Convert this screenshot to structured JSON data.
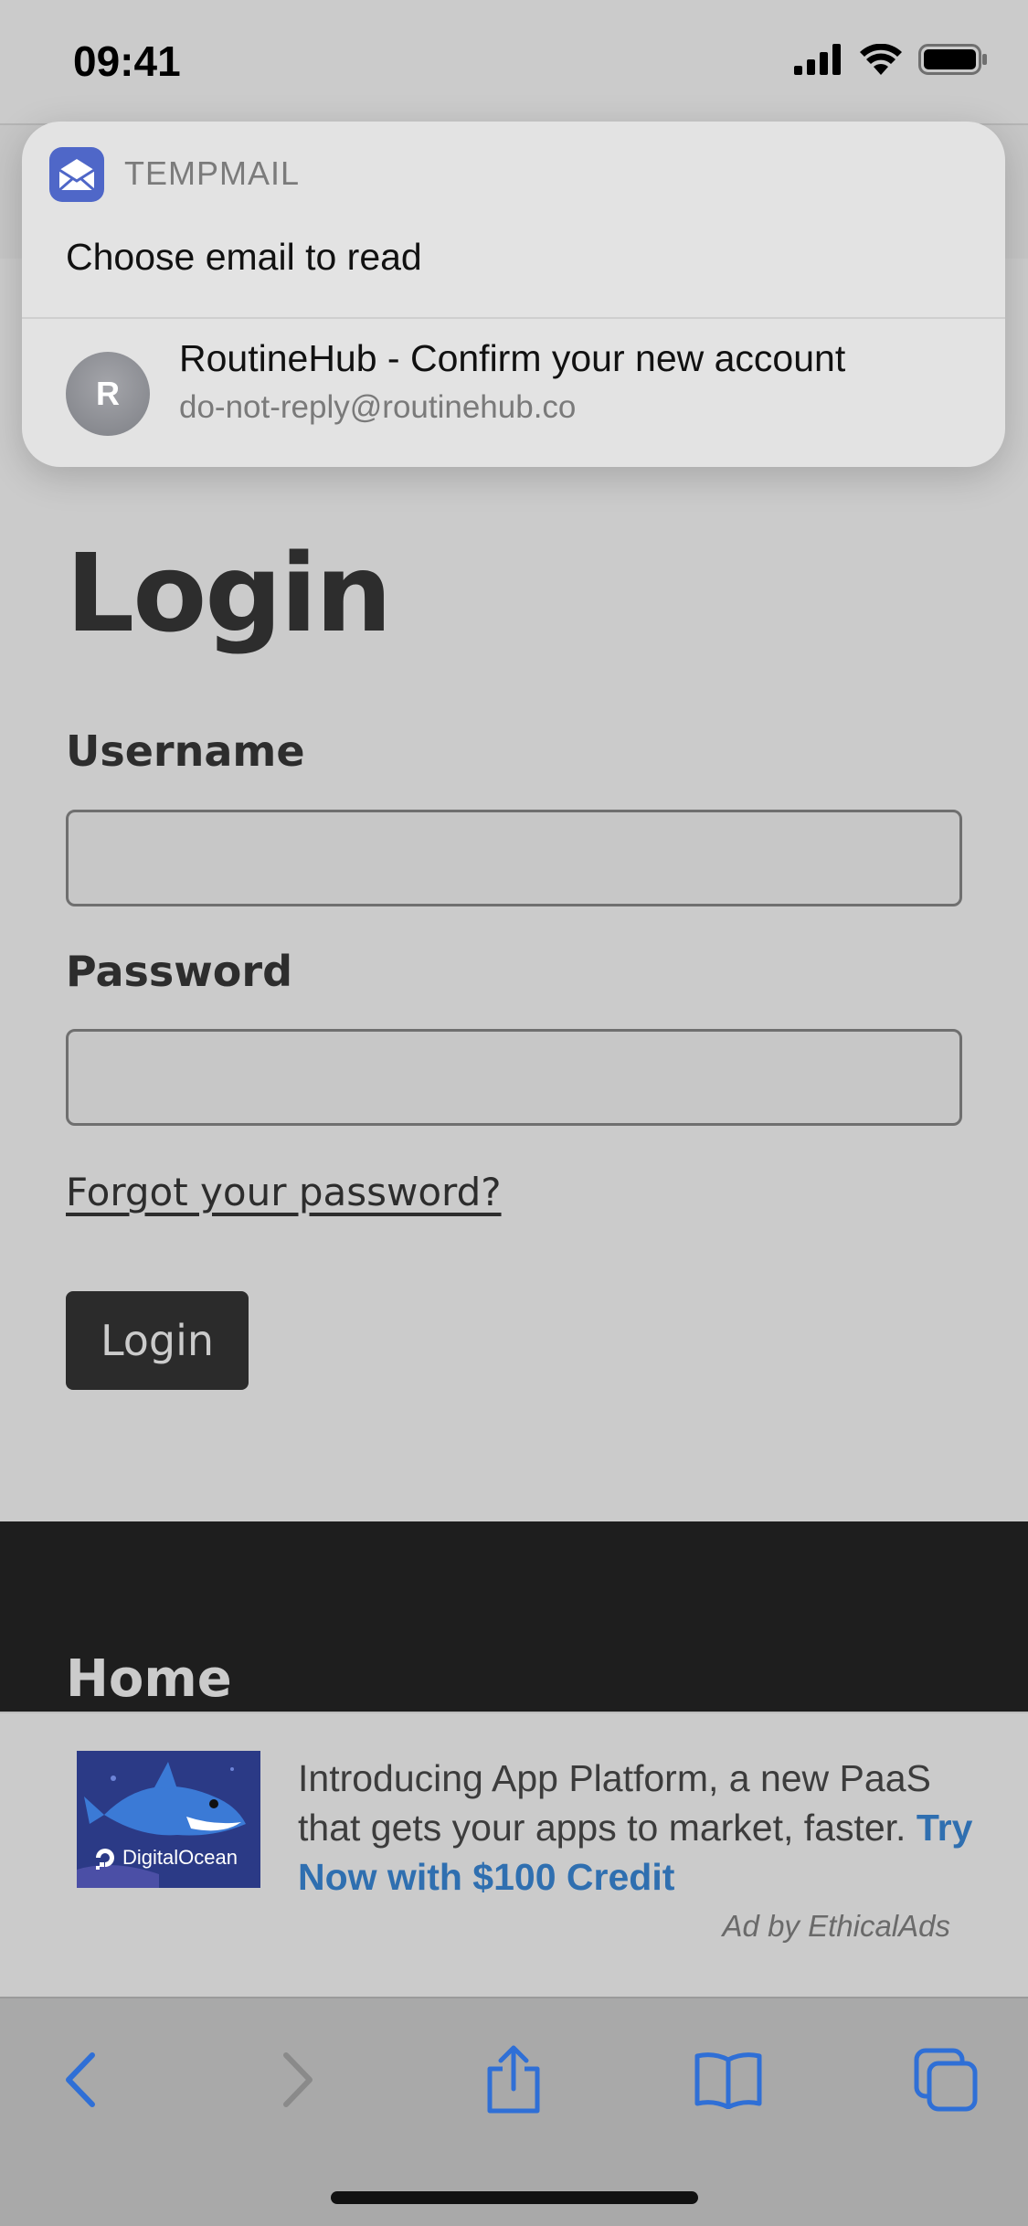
{
  "status_bar": {
    "time": "09:41"
  },
  "notification": {
    "app_name": "TEMPMAIL",
    "title": "Choose email to read",
    "email": {
      "avatar_initial": "R",
      "subject": "RoutineHub - Confirm your new account",
      "sender": "do-not-reply@routinehub.co"
    },
    "app_icon": "envelope-icon",
    "accent_color": "#4f67c8"
  },
  "login": {
    "heading": "Login",
    "username_label": "Username",
    "username_value": "",
    "password_label": "Password",
    "password_value": "",
    "forgot_link": "Forgot your password?",
    "button_label": "Login"
  },
  "footer": {
    "home_label": "Home"
  },
  "ad": {
    "image_brand": "DigitalOcean",
    "text": "Introducing App Platform, a new PaaS that gets your apps to market, faster.",
    "cta": "Try Now with $100 Credit",
    "credit": "Ad by EthicalAds",
    "cta_color": "#2f6fb0"
  },
  "toolbar": {
    "icons": [
      "back-icon",
      "forward-icon",
      "share-icon",
      "bookmarks-icon",
      "tabs-icon"
    ],
    "accent_color": "#2f6fd6"
  }
}
